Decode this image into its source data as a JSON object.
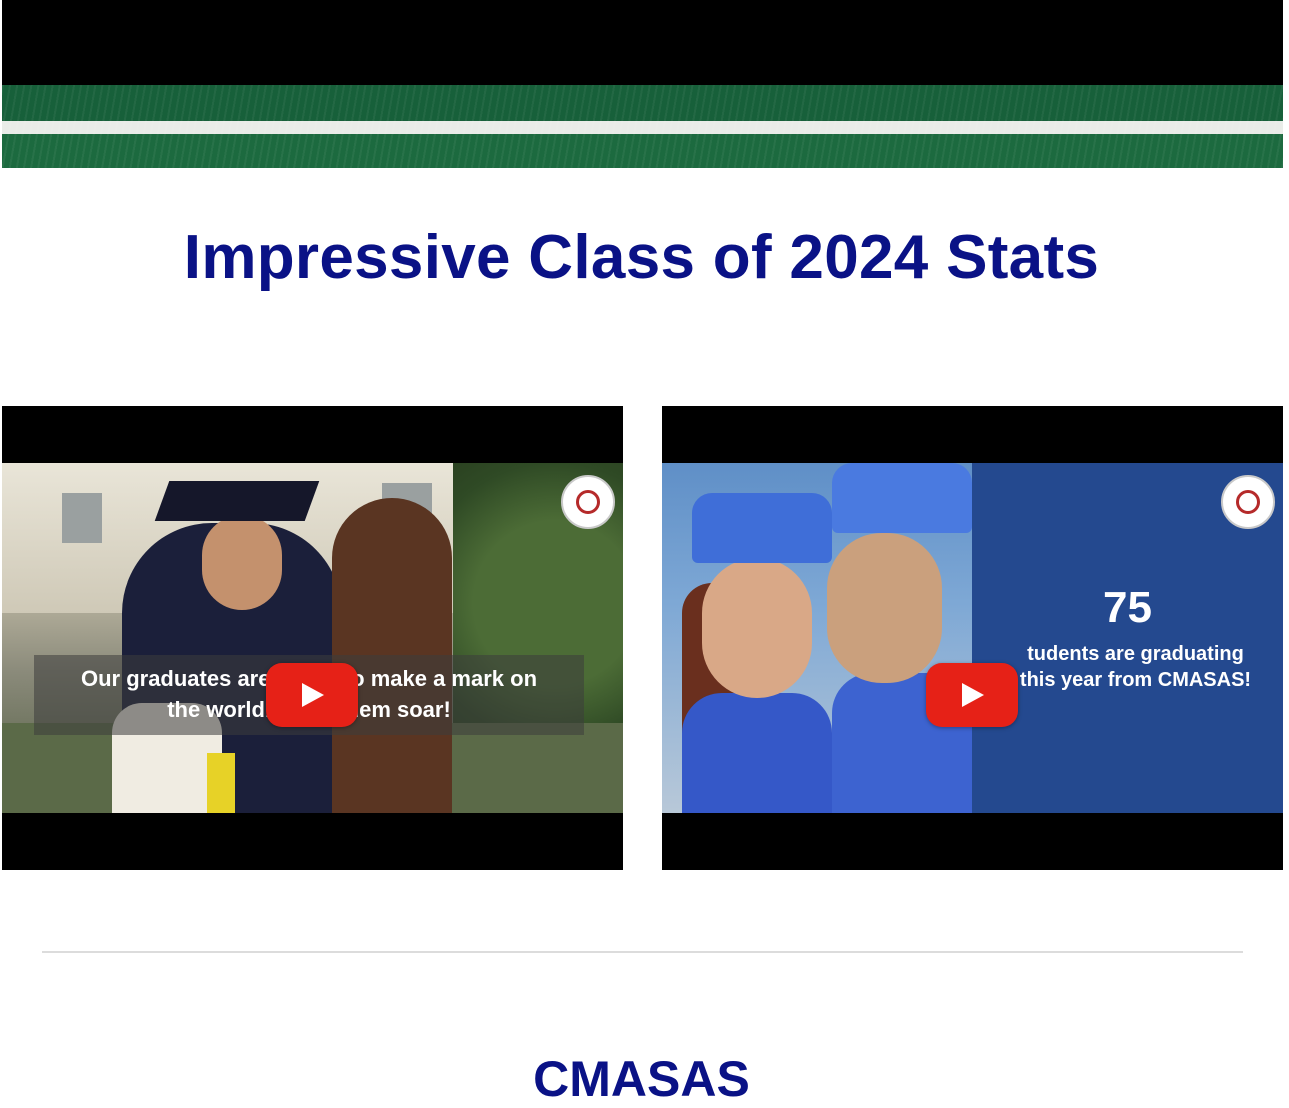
{
  "header": {
    "colors": {
      "black": "#000000",
      "green": "#17603a",
      "stripe": "#e9ece8"
    }
  },
  "main": {
    "title": "Impressive Class of 2024 Stats",
    "title_color": "#0a1286",
    "videos": [
      {
        "caption_line1": "Our graduates are            to make a mark on",
        "caption_line2": "the world.           them soar!",
        "play_icon": "youtube-play-icon",
        "logo_icon": "school-seal-icon"
      },
      {
        "stat_number": "75",
        "stat_line1": "tudents are graduating",
        "stat_line2": "this year from CMASAS!",
        "play_icon": "youtube-play-icon",
        "logo_icon": "school-seal-icon"
      }
    ],
    "section_heading": "CMASAS"
  }
}
